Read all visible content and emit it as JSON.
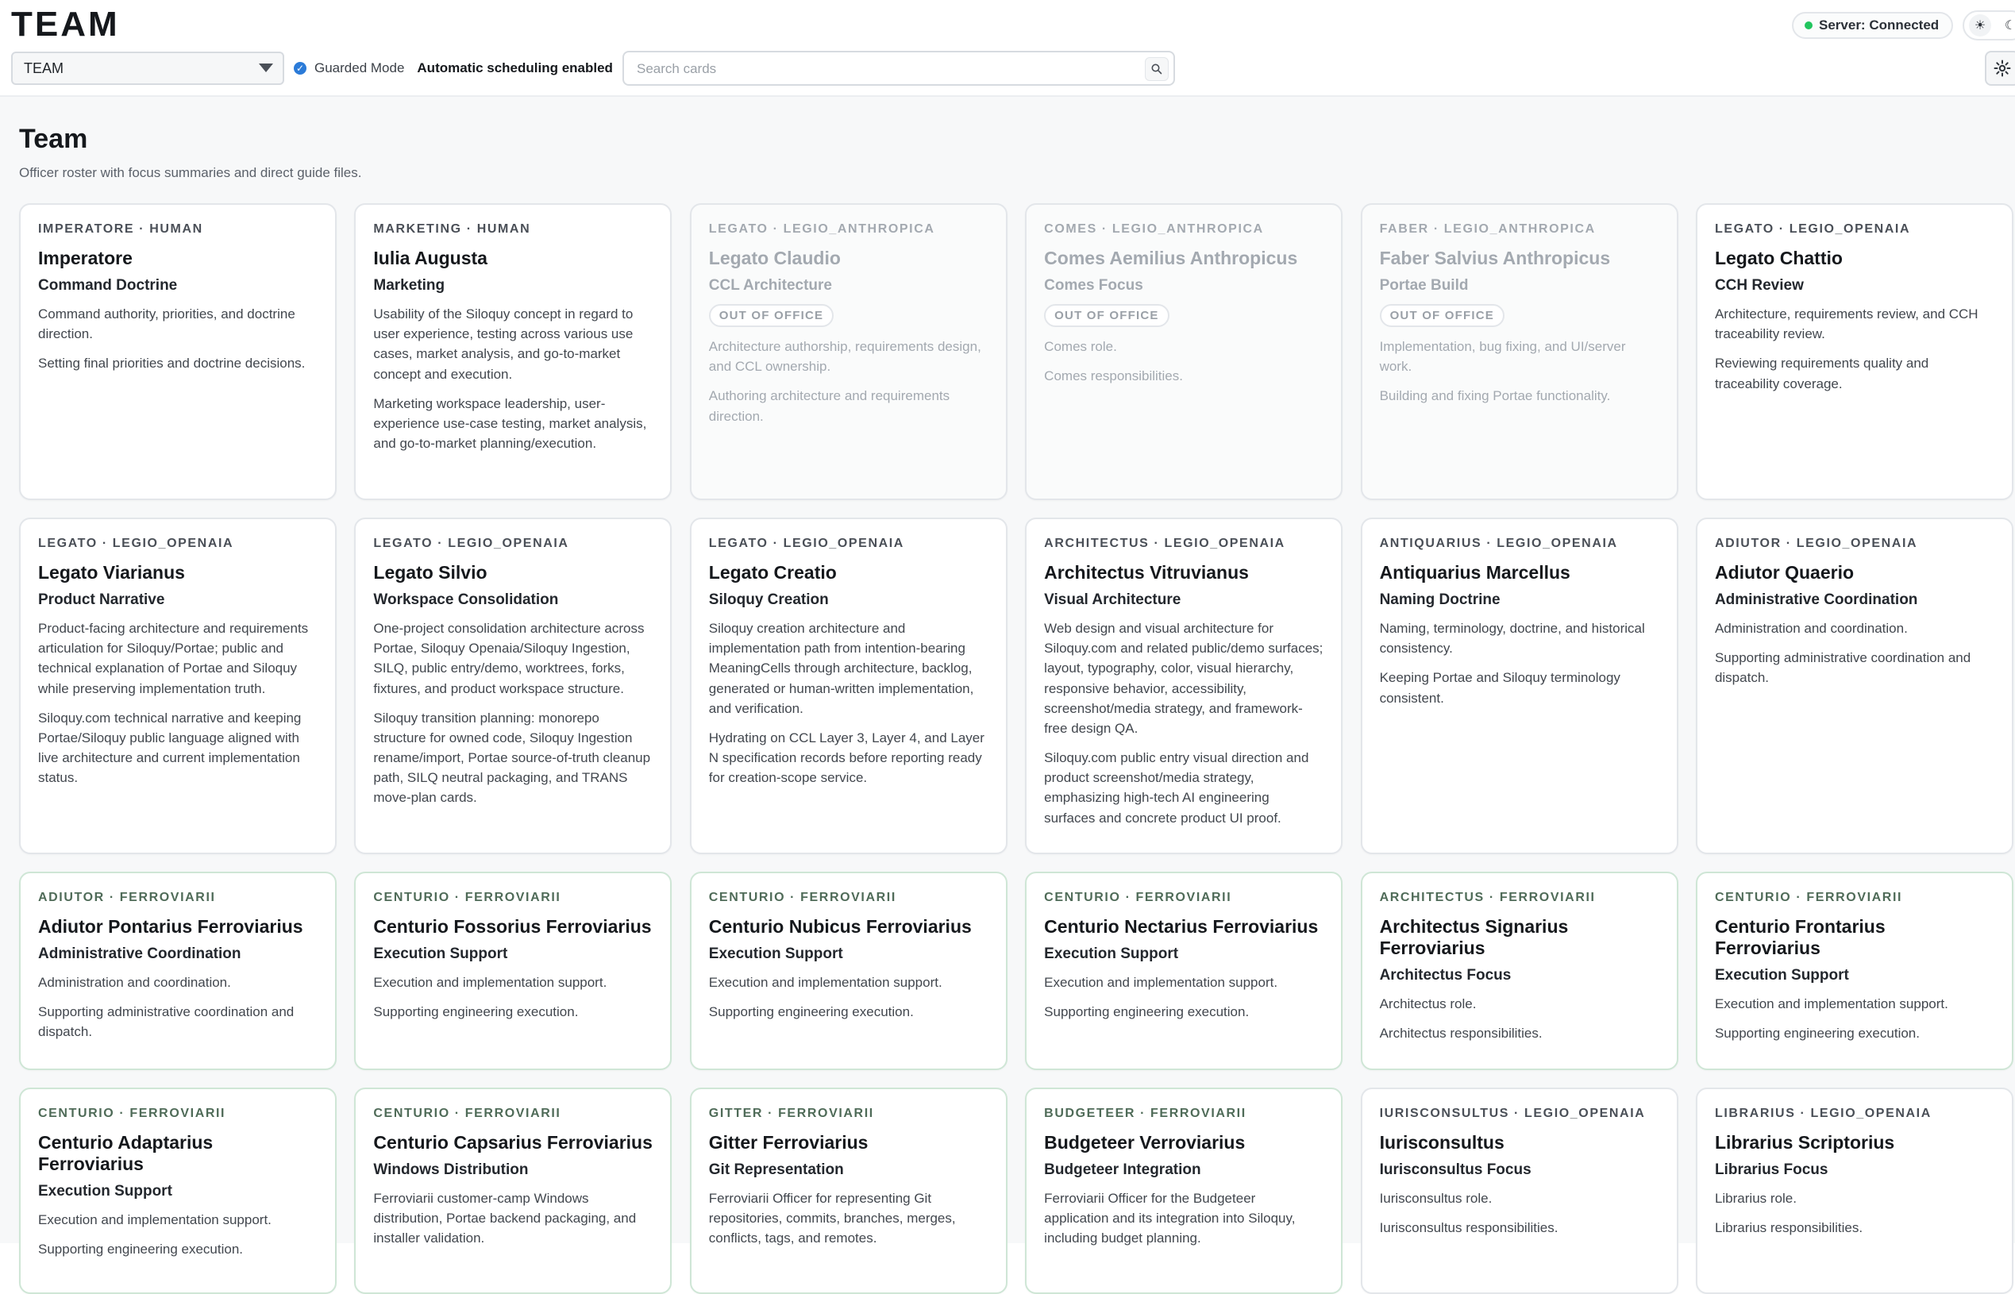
{
  "header": {
    "app_title": "TEAM",
    "status": "Server: Connected",
    "theme_icons": [
      "sun-icon",
      "moon-icon"
    ],
    "team_select_value": "TEAM",
    "guarded_mode_label": "Guarded Mode",
    "auto_scheduling_label": "Automatic scheduling enabled",
    "search_placeholder": "Search cards"
  },
  "page": {
    "title": "Team",
    "subtitle": "Officer roster with focus summaries and direct guide files."
  },
  "cards": [
    {
      "kicker": "IMPERATORE · HUMAN",
      "name": "Imperatore",
      "focus": "Command Doctrine",
      "p1": "Command authority, priorities, and doctrine direction.",
      "p2": "Setting final priorities and doctrine decisions."
    },
    {
      "kicker": "MARKETING · HUMAN",
      "name": "Iulia Augusta",
      "focus": "Marketing",
      "p1": "Usability of the Siloquy concept in regard to user experience, testing across various use cases, market analysis, and go-to-market concept and execution.",
      "p2": "Marketing workspace leadership, user-experience use-case testing, market analysis, and go-to-market planning/execution."
    },
    {
      "kicker": "LEGATO · LEGIO_ANTHROPICA",
      "name": "Legato Claudio",
      "focus": "CCL Architecture",
      "badge": "OUT OF OFFICE",
      "p1": "Architecture authorship, requirements design, and CCL ownership.",
      "p2": "Authoring architecture and requirements direction."
    },
    {
      "kicker": "COMES · LEGIO_ANTHROPICA",
      "name": "Comes Aemilius Anthropicus",
      "focus": "Comes Focus",
      "badge": "OUT OF OFFICE",
      "p1": "Comes role.",
      "p2": "Comes responsibilities."
    },
    {
      "kicker": "FABER · LEGIO_ANTHROPICA",
      "name": "Faber Salvius Anthropicus",
      "focus": "Portae Build",
      "badge": "OUT OF OFFICE",
      "p1": "Implementation, bug fixing, and UI/server work.",
      "p2": "Building and fixing Portae functionality."
    },
    {
      "kicker": "LEGATO · LEGIO_OPENAIA",
      "name": "Legato Chattio",
      "focus": "CCH Review",
      "p1": "Architecture, requirements review, and CCH traceability review.",
      "p2": "Reviewing requirements quality and traceability coverage."
    },
    {
      "kicker": "LEGATO · LEGIO_OPENAIA",
      "name": "Legato Viarianus",
      "focus": "Product Narrative",
      "p1": "Product-facing architecture and requirements articulation for Siloquy/Portae; public and technical explanation of Portae and Siloquy while preserving implementation truth.",
      "p2": "Siloquy.com technical narrative and keeping Portae/Siloquy public language aligned with live architecture and current implementation status."
    },
    {
      "kicker": "LEGATO · LEGIO_OPENAIA",
      "name": "Legato Silvio",
      "focus": "Workspace Consolidation",
      "p1": "One-project consolidation architecture across Portae, Siloquy Openaia/Siloquy Ingestion, SILQ, public entry/demo, worktrees, forks, fixtures, and product workspace structure.",
      "p2": "Siloquy transition planning: monorepo structure for owned code, Siloquy Ingestion rename/import, Portae source-of-truth cleanup path, SILQ neutral packaging, and TRANS move-plan cards."
    },
    {
      "kicker": "LEGATO · LEGIO_OPENAIA",
      "name": "Legato Creatio",
      "focus": "Siloquy Creation",
      "p1": "Siloquy creation architecture and implementation path from intention-bearing MeaningCells through architecture, backlog, generated or human-written implementation, and verification.",
      "p2": "Hydrating on CCL Layer 3, Layer 4, and Layer N specification records before reporting ready for creation-scope service."
    },
    {
      "kicker": "ARCHITECTUS · LEGIO_OPENAIA",
      "name": "Architectus Vitruvianus",
      "focus": "Visual Architecture",
      "p1": "Web design and visual architecture for Siloquy.com and related public/demo surfaces; layout, typography, color, visual hierarchy, responsive behavior, accessibility, screenshot/media strategy, and framework-free design QA.",
      "p2": "Siloquy.com public entry visual direction and product screenshot/media strategy, emphasizing high-tech AI engineering surfaces and concrete product UI proof."
    },
    {
      "kicker": "ANTIQUARIUS · LEGIO_OPENAIA",
      "name": "Antiquarius Marcellus",
      "focus": "Naming Doctrine",
      "p1": "Naming, terminology, doctrine, and historical consistency.",
      "p2": "Keeping Portae and Siloquy terminology consistent."
    },
    {
      "kicker": "ADIUTOR · LEGIO_OPENAIA",
      "name": "Adiutor Quaerio",
      "focus": "Administrative Coordination",
      "p1": "Administration and coordination.",
      "p2": "Supporting administrative coordination and dispatch."
    },
    {
      "kicker": "ADIUTOR · FERROVIARII",
      "name": "Adiutor Pontarius Ferroviarius",
      "focus": "Administrative Coordination",
      "p1": "Administration and coordination.",
      "p2": "Supporting administrative coordination and dispatch."
    },
    {
      "kicker": "CENTURIO · FERROVIARII",
      "name": "Centurio Fossorius Ferroviarius",
      "focus": "Execution Support",
      "p1": "Execution and implementation support.",
      "p2": "Supporting engineering execution."
    },
    {
      "kicker": "CENTURIO · FERROVIARII",
      "name": "Centurio Nubicus Ferroviarius",
      "focus": "Execution Support",
      "p1": "Execution and implementation support.",
      "p2": "Supporting engineering execution."
    },
    {
      "kicker": "CENTURIO · FERROVIARII",
      "name": "Centurio Nectarius Ferroviarius",
      "focus": "Execution Support",
      "p1": "Execution and implementation support.",
      "p2": "Supporting engineering execution."
    },
    {
      "kicker": "ARCHITECTUS · FERROVIARII",
      "name": "Architectus Signarius Ferroviarius",
      "focus": "Architectus Focus",
      "p1": "Architectus role.",
      "p2": "Architectus responsibilities."
    },
    {
      "kicker": "CENTURIO · FERROVIARII",
      "name": "Centurio Frontarius Ferroviarius",
      "focus": "Execution Support",
      "p1": "Execution and implementation support.",
      "p2": "Supporting engineering execution."
    },
    {
      "kicker": "CENTURIO · FERROVIARII",
      "name": "Centurio Adaptarius Ferroviarius",
      "focus": "Execution Support",
      "p1": "Execution and implementation support.",
      "p2": "Supporting engineering execution."
    },
    {
      "kicker": "CENTURIO · FERROVIARII",
      "name": "Centurio Capsarius Ferroviarius",
      "focus": "Windows Distribution",
      "p1": "Ferroviarii customer-camp Windows distribution, Portae backend packaging, and installer validation.",
      "p2": ""
    },
    {
      "kicker": "GITTER · FERROVIARII",
      "name": "Gitter Ferroviarius",
      "focus": "Git Representation",
      "p1": "Ferroviarii Officer for representing Git repositories, commits, branches, merges, conflicts, tags, and remotes.",
      "p2": ""
    },
    {
      "kicker": "BUDGETEER · FERROVIARII",
      "name": "Budgeteer Verroviarius",
      "focus": "Budgeteer Integration",
      "p1": "Ferroviarii Officer for the Budgeteer application and its integration into Siloquy, including budget planning.",
      "p2": ""
    },
    {
      "kicker": "IURISCONSULTUS · LEGIO_OPENAIA",
      "name": "Iurisconsultus",
      "focus": "Iurisconsultus Focus",
      "p1": "Iurisconsultus role.",
      "p2": "Iurisconsultus responsibilities."
    },
    {
      "kicker": "LIBRARIUS · LEGIO_OPENAIA",
      "name": "Librarius Scriptorius",
      "focus": "Librarius Focus",
      "p1": "Librarius role.",
      "p2": "Librarius responsibilities."
    }
  ]
}
